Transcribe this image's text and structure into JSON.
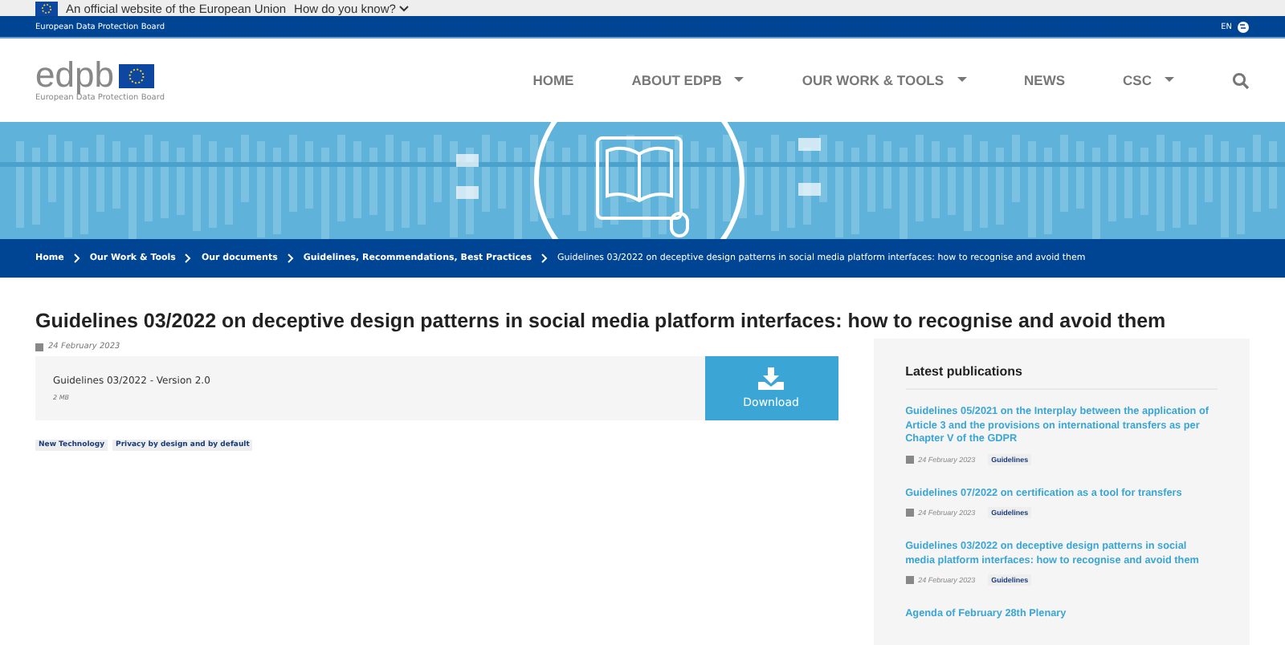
{
  "eu_bar": {
    "text": "An official website of the European Union",
    "link": "How do you know?"
  },
  "site_bar": {
    "name": "European Data Protection Board",
    "language": "EN"
  },
  "header": {
    "logo_text": "edpb",
    "logo_subtitle": "European Data Protection Board",
    "nav": [
      {
        "label": "HOME",
        "dropdown": false
      },
      {
        "label": "ABOUT EDPB",
        "dropdown": true
      },
      {
        "label": "OUR WORK & TOOLS",
        "dropdown": true
      },
      {
        "label": "NEWS",
        "dropdown": false
      },
      {
        "label": "CSC",
        "dropdown": true
      }
    ]
  },
  "breadcrumb": [
    "Home",
    "Our Work & Tools",
    "Our documents",
    "Guidelines, Recommendations, Best Practices",
    "Guidelines 03/2022 on deceptive design patterns in social media platform interfaces: how to recognise and avoid them"
  ],
  "title": "Guidelines 03/2022 on deceptive design patterns in social media platform interfaces: how to recognise and avoid them",
  "date": "24 February 2023",
  "file": {
    "name": "Guidelines 03/2022 - Version 2.0",
    "size": "2 MB",
    "button": "Download"
  },
  "tags": [
    "New Technology",
    "Privacy by design and by default"
  ],
  "sidebar": {
    "title": "Latest publications",
    "items": [
      {
        "title": "Guidelines 05/2021 on the Interplay between the application of Article 3 and the provisions on international transfers as per Chapter V of the GDPR",
        "date": "24 February 2023",
        "tag": "Guidelines"
      },
      {
        "title": "Guidelines 07/2022 on certification as a tool for transfers",
        "date": "24 February 2023",
        "tag": "Guidelines"
      },
      {
        "title": "Guidelines 03/2022 on deceptive design patterns in social media platform interfaces: how to recognise and avoid them",
        "date": "24 February 2023",
        "tag": "Guidelines"
      },
      {
        "title": "Agenda of February 28th Plenary"
      }
    ]
  }
}
